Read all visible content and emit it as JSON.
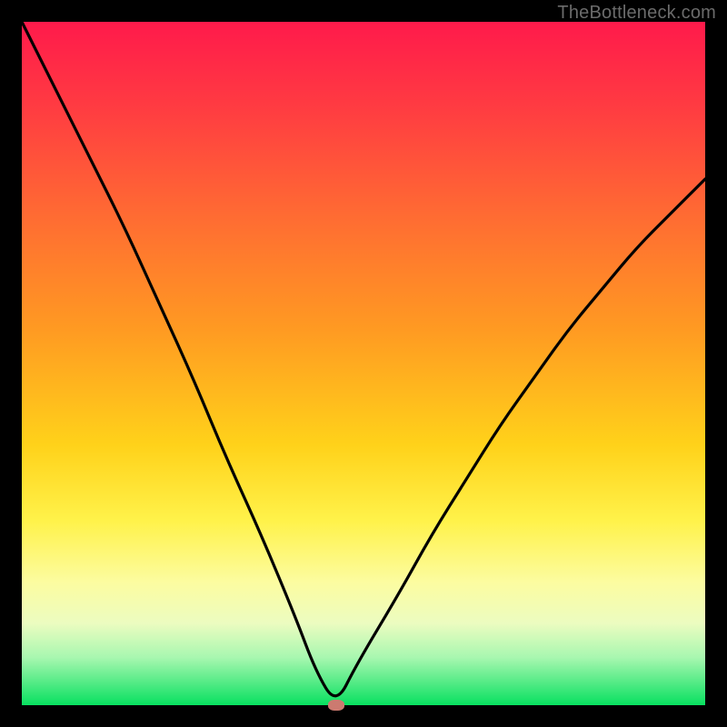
{
  "watermark": "TheBottleneck.com",
  "colors": {
    "frame": "#000000",
    "gradient_top": "#ff1a4b",
    "gradient_bottom": "#08e060",
    "curve": "#000000",
    "marker": "#cc7a70"
  },
  "chart_data": {
    "type": "line",
    "title": "",
    "xlabel": "",
    "ylabel": "",
    "xlim": [
      0,
      100
    ],
    "ylim": [
      0,
      100
    ],
    "grid": false,
    "legend": false,
    "description": "V-shaped bottleneck curve with sharp minimum near x≈46, overlaid on red→green vertical gradient background",
    "series": [
      {
        "name": "curve",
        "x": [
          0,
          5,
          10,
          15,
          20,
          25,
          30,
          35,
          40,
          43,
          46,
          49,
          55,
          60,
          65,
          70,
          75,
          80,
          85,
          90,
          95,
          100
        ],
        "y": [
          100,
          90,
          80,
          70,
          59,
          48,
          36,
          25,
          13,
          5,
          0,
          6,
          16,
          25,
          33,
          41,
          48,
          55,
          61,
          67,
          72,
          77
        ]
      }
    ],
    "marker": {
      "x": 46,
      "y": 0
    },
    "notes": "Axes unlabeled; values estimated from pixel positions on a 0–100 normalized scale."
  }
}
